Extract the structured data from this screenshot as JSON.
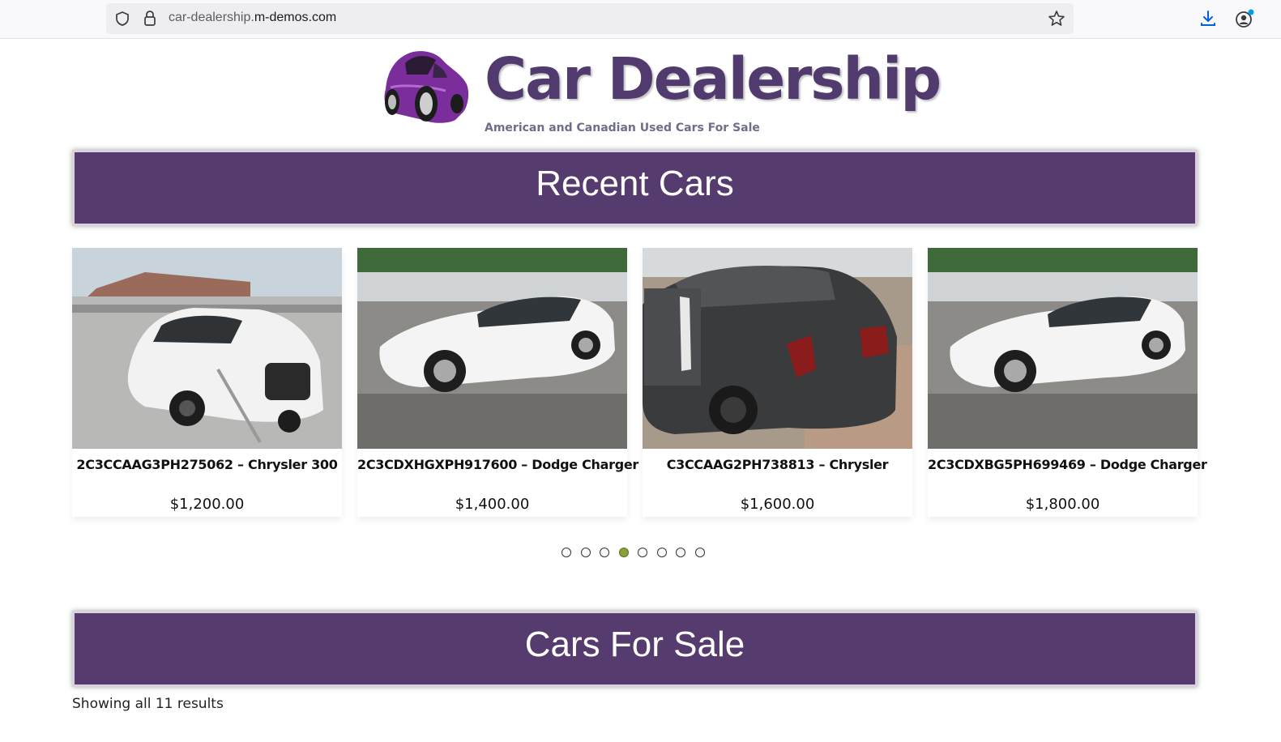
{
  "browser": {
    "url_subdomain": "car-dealership.",
    "url_domain": "m-demos.com",
    "icons": [
      "shield-icon",
      "lock-icon",
      "star-icon",
      "download-icon",
      "account-icon"
    ]
  },
  "site": {
    "title": "Car Dealership",
    "tagline": "American and Canadian Used Cars For Sale",
    "brand_color": "#563b6f"
  },
  "recent_section": {
    "heading": "Recent Cars"
  },
  "cars": [
    {
      "title": "2C3CCAAG3PH275062 – Chrysler 300",
      "price": "$1,200.00"
    },
    {
      "title": "2C3CDXHGXPH917600 – Dodge Charger",
      "price": "$1,400.00"
    },
    {
      "title": "C3CCAAG2PH738813 – Chrysler",
      "price": "$1,600.00"
    },
    {
      "title": "2C3CDXBG5PH699469 – Dodge Charger",
      "price": "$1,800.00"
    }
  ],
  "carousel": {
    "dot_count": 8,
    "active_index": 3,
    "active_color": "#8aa03a"
  },
  "sale_section": {
    "heading": "Cars For Sale",
    "results_text": "Showing all 11 results"
  }
}
